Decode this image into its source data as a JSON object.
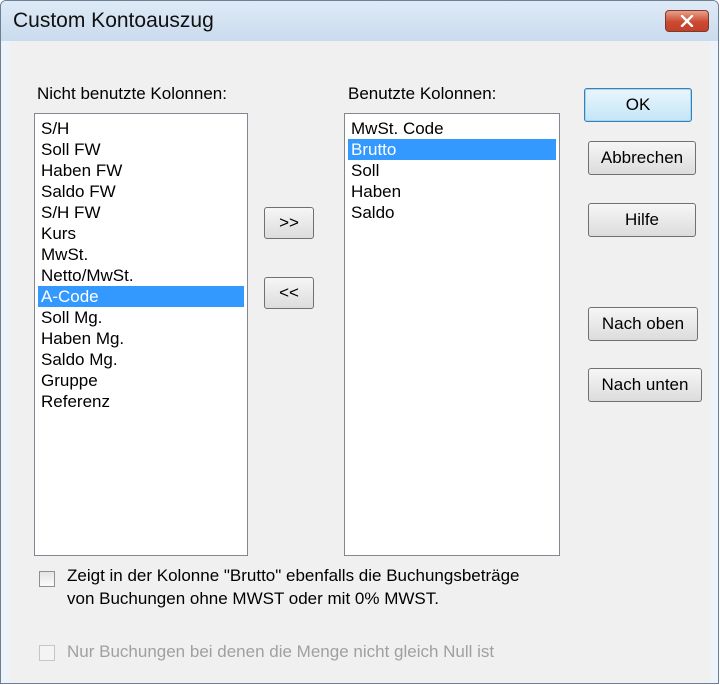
{
  "window": {
    "title": "Custom Kontoauszug"
  },
  "left_list": {
    "label": "Nicht benutzte Kolonnen:",
    "items": [
      "S/H",
      "Soll FW",
      "Haben FW",
      "Saldo FW",
      "S/H FW",
      "Kurs",
      "MwSt.",
      "Netto/MwSt.",
      "A-Code",
      "Soll Mg.",
      "Haben Mg.",
      "Saldo Mg.",
      "Gruppe",
      "Referenz"
    ],
    "selected": "A-Code"
  },
  "right_list": {
    "label": "Benutzte Kolonnen:",
    "items": [
      "MwSt. Code",
      "Brutto",
      "Soll",
      "Haben",
      "Saldo"
    ],
    "selected": "Brutto"
  },
  "move": {
    "add_label": ">>",
    "remove_label": "<<"
  },
  "buttons": {
    "ok": "OK",
    "cancel": "Abbrechen",
    "help": "Hilfe",
    "up": "Nach oben",
    "down": "Nach unten"
  },
  "options": {
    "brutto_line1": "Zeigt in der Kolonne \"Brutto\" ebenfalls die Buchungsbeträge",
    "brutto_line2": "von Buchungen ohne MWST oder mit 0% MWST.",
    "brutto_checked": false,
    "quantity_label": "Nur Buchungen bei denen die Menge nicht gleich Null ist",
    "quantity_checked": false,
    "quantity_enabled": false
  },
  "colors": {
    "selection": "#3399ff",
    "close_button": "#c94a33"
  },
  "icons": {
    "close": "close-icon"
  }
}
